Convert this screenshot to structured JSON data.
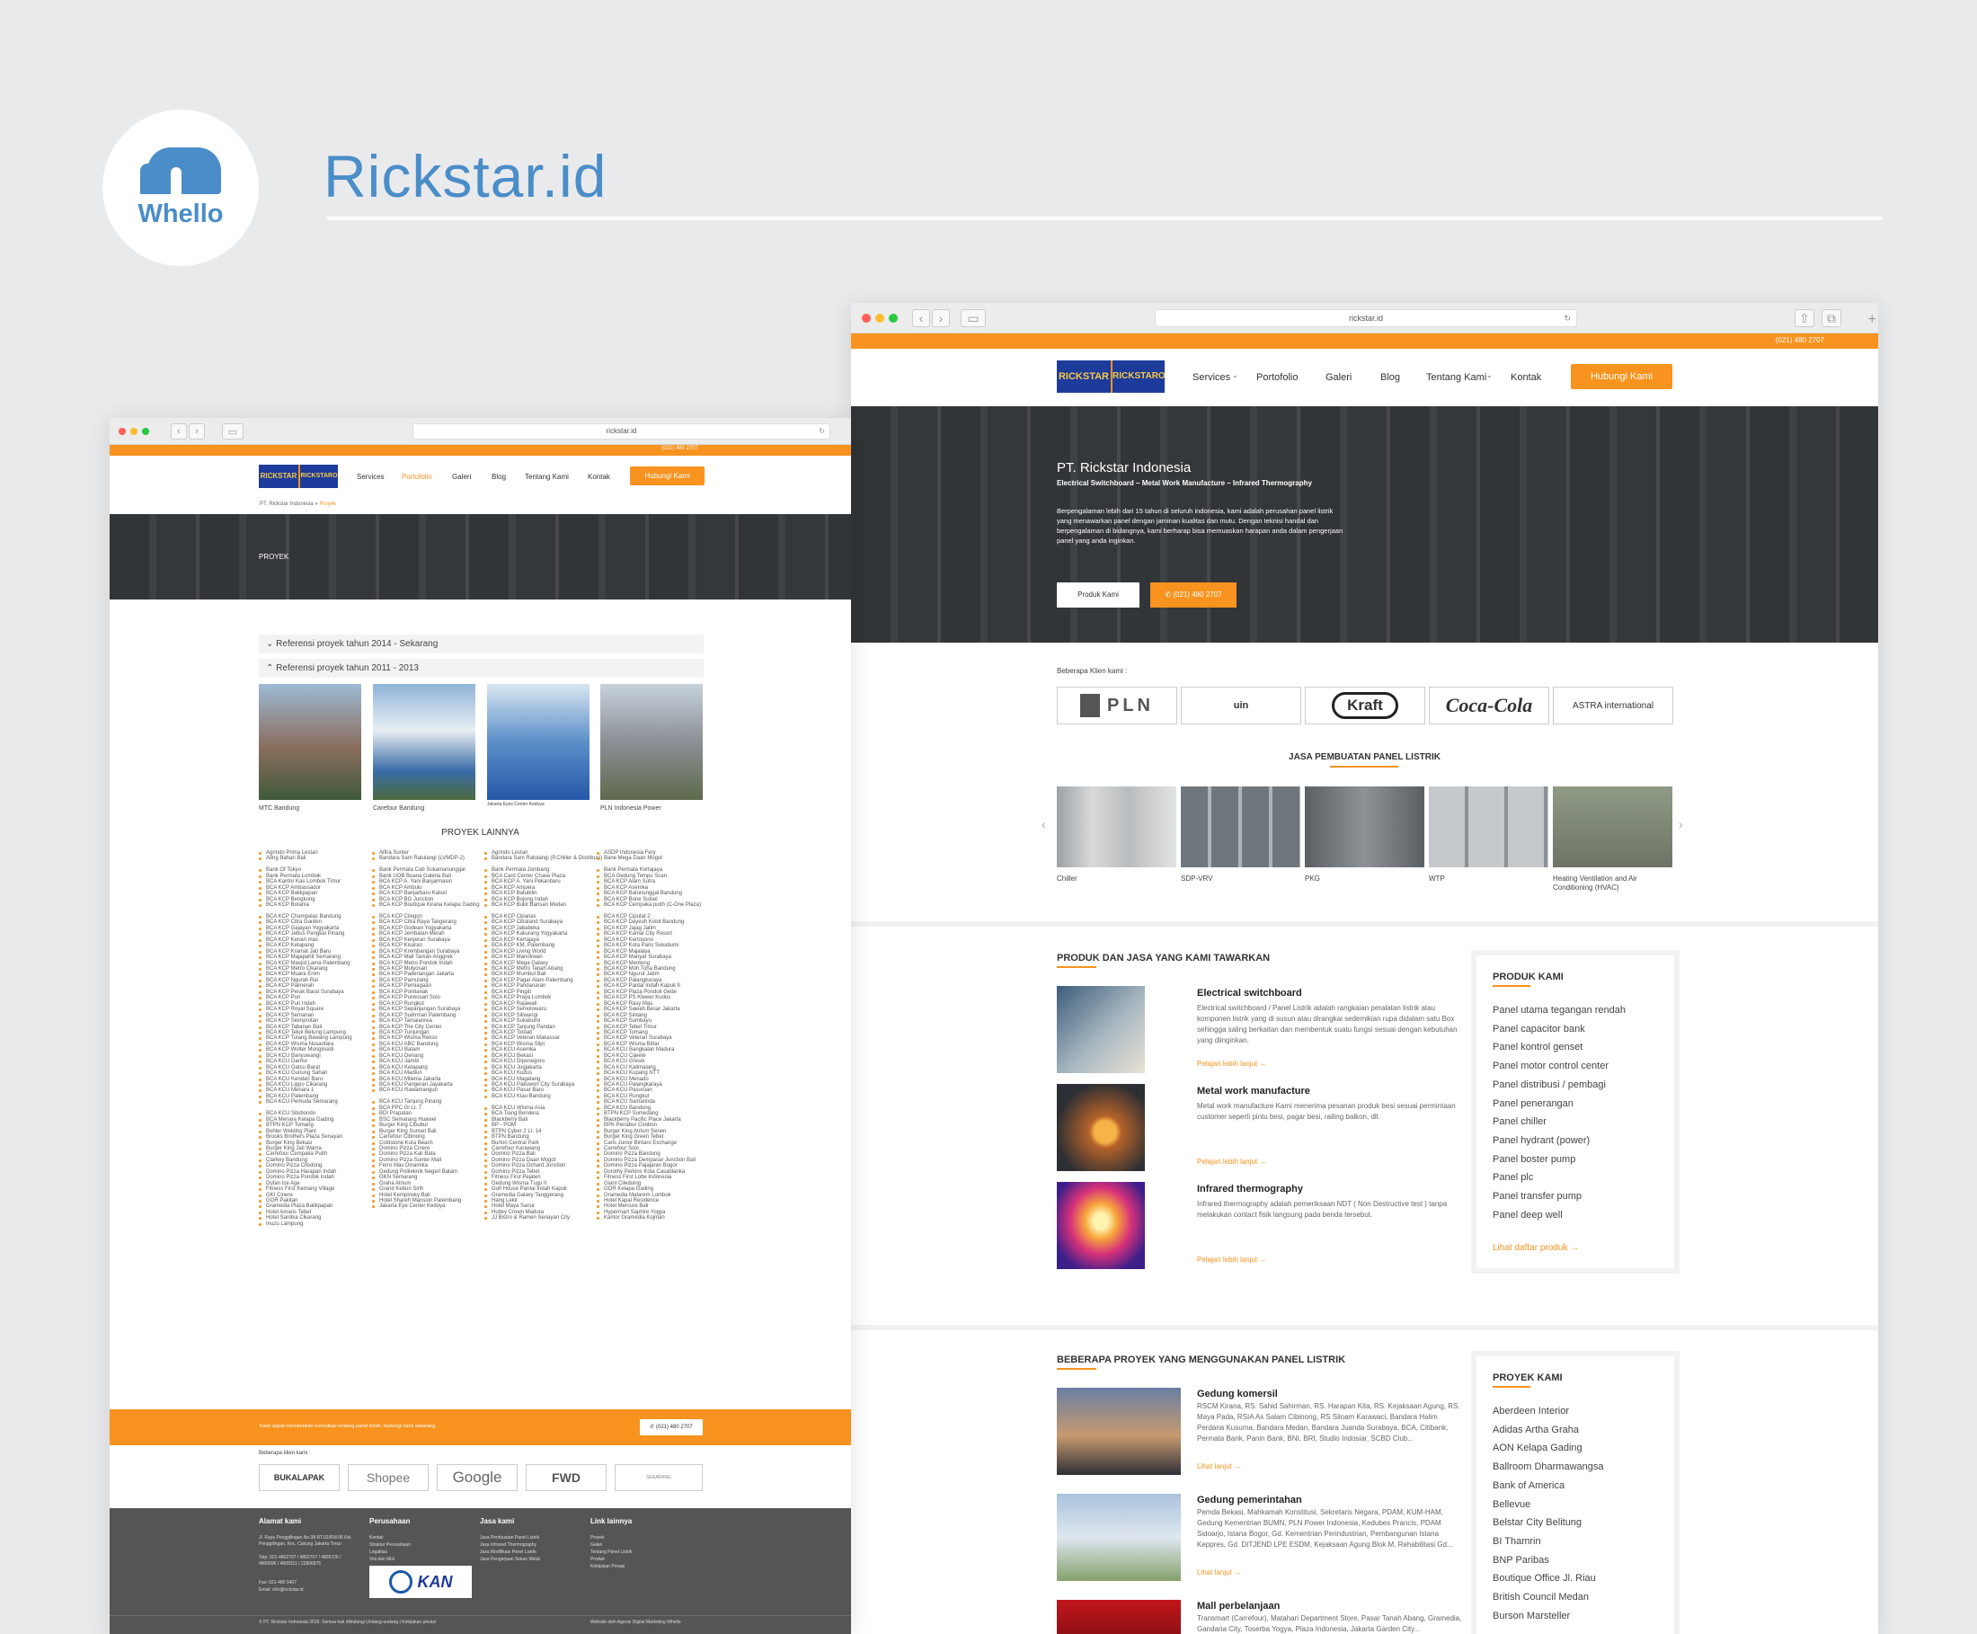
{
  "brand": {
    "logo_text": "Whello",
    "title": "Rickstar.id"
  },
  "browser": {
    "url": "rickstar.id"
  },
  "site": {
    "phone": "(021) 480 2707",
    "brand_left": "RICKSTAR",
    "brand_right": "RICKSTARO",
    "nav": [
      "Services",
      "Portofolio",
      "Galeri",
      "Blog",
      "Tentang Kami",
      "Kontak"
    ],
    "cta": "Hubungi Kami"
  },
  "left": {
    "breadcrumb_root": "PT. Rickstar Indonesia",
    "breadcrumb_current": "Proyek",
    "hero_title": "PROYEK",
    "accordion": [
      "Referensi proyek tahun 2014 - Sekarang",
      "Referensi proyek tahun 2011 - 2013"
    ],
    "photos": [
      "MTC Bandung",
      "Carefour Bandung",
      "Jakarta Eyes Center Kedoya",
      "PLN Indonesia Power"
    ],
    "others_title": "PROYEK LAINNYA",
    "col1": [
      "Agrindo Prima Lestari",
      "Ating Bahari Bali",
      "",
      "Bank Of Tokyo",
      "Bank Permata Lombok",
      "BCA Kantor Kas Lombok Timur",
      "BCA KCP Ambassador",
      "BCA KCP Balikpapan",
      "BCA KCP Bengkong",
      "BCA KCP Botania",
      "",
      "BCA KCP Champalas Bandung",
      "BCA KCP Citra Garden",
      "BCA KCP Gajayan Yogyakarta",
      "BCA KCP Jebus Pangkal Pinang",
      "BCA KCP Kenari mas",
      "BCA KCP Ketapang",
      "BCA KCP Kramat Jati Baru",
      "BCA KCP Majapahit Semarang",
      "BCA KCP Masjid Lama Palembang",
      "BCA KCP Metro Cikarang",
      "BCA KCP Muara Enim",
      "BCA KCP Ngurah Rai",
      "BCA KCP Palmerah",
      "BCA KCP Perak Barat Surabaya",
      "BCA KCP Puri",
      "BCA KCP Puri Indah",
      "BCA KCP Royal Square",
      "BCA KCP Semanan",
      "BCA KCP Siomprotan",
      "BCA KCP Tabanan Bali",
      "BCA KCP Teluk Betung Lampung",
      "BCA KCP Tulang Bawang Lampung",
      "BCA KCP Wisma Nusantara",
      "BCA KCP Wolter Monginsidi",
      "BCA KCU Banyuwangi",
      "BCA KCU Darmo",
      "BCA KCU Gatsu Barat",
      "BCA KCU Gunung Sahari",
      "BCA KCU Kendari Baru",
      "BCA KCU Lippo Cikarang",
      "BCA KCU Menara 1",
      "BCA KCU Palembang",
      "BCA KCU Pemuda Semarang",
      "",
      "BCA KCU Situbondo",
      "BCA Menara Kelapa Gading",
      "BTPN KCP Tomang",
      "Bohler Welding Plant",
      "Brooks Brothers Plaza Senayan",
      "Burger King Bekasi",
      "Burger King Jati Warna",
      "Carrefour Cempaka Putih",
      "Clarkey Bandung",
      "Domino Pizza Cilodong",
      "Domino Pizza Harapan Indah",
      "Domino Pizza Pondok Indah",
      "Dufan Ice Age",
      "Fitness First Kemang Village",
      "GKI Cinere",
      "GOR Pakitan",
      "Gramedia Plaza Balikpapan",
      "Hotel Amaris Tebet",
      "Hotel Santika Cikarang",
      "Inuzu Lampung"
    ],
    "col2": [
      "Alfira Sunter",
      "Bandara Sam Ratulangi (LVMDP-2)",
      "",
      "Bank Permata Cab Sukamanunggal",
      "Bank UOB Buana Galeria Bali",
      "BCA KCP A. Yani Banjarmasin",
      "BCA KCP Ambulu",
      "BCA KCP Banjarbaru Kalsel",
      "BCA KCP BG Junction",
      "BCA KCP Boutique Kirana Kelapa Gading",
      "",
      "BCA KCP Cilegon",
      "BCA KCP Citra Raya Tangerang",
      "BCA KCP Godean Yogyakarta",
      "BCA KCP Jembatan Merah",
      "BCA KCP Kenjeran Surabaya",
      "BCA KCP Kisaran",
      "BCA KCP Krembangan Surabaya",
      "BCA KCP Mall Taman Anggrek",
      "BCA KCP Metro Pondok Indah",
      "BCA KCP Mulyosari",
      "BCA KCP Padenangan Jakarta",
      "BCA KCP Pamulang",
      "BCA KCP Pemiagaan",
      "BCA KCP Pontianak",
      "BCA KCP Purwosari Solo",
      "BCA KCP Rungkut",
      "BCA KCP Sepanjangan Surabaya",
      "BCA KCP Sudirman Palembang",
      "BCA KCP Tamalanrea",
      "BCA KCP The City Center",
      "BCA KCP Tunjungan",
      "BCA KCP Wisma Rekso",
      "BCA KCU ABC Bandung",
      "BCA KCU Batam",
      "BCA KCU Denang",
      "BCA KCU Jambi",
      "BCA KCU Ketapang",
      "BCA KCU Madiun",
      "BCA KCU Milenia Jakarta",
      "BCA KCU Pangeran Jayakarta",
      "BCA KCU Rawamangun",
      "",
      "BCA KCU Tanjung Pinang",
      "BCA PPC Gl Lt. 7",
      "BDI Prapatan",
      "BSC Semarang Huawei",
      "Burger King Cibubur",
      "Burger King Sunset Bali",
      "Carrefour Cibinong",
      "Coldstone Kuta Beach",
      "Domino Pizza Cinere",
      "Domino Pizza Kali Bata",
      "Domino Pizza Sunter Mall",
      "Ferro Mas Dinamika",
      "Gedung Politeknik Negeri Batam",
      "GKN Semarang",
      "Graha Atrium",
      "Grand Kebon Sirih",
      "Hotel Kempinsky Bali",
      "Hotel Shareh Mansion Palembang",
      "Jakarta Eye Center Kedoya"
    ],
    "col3": [
      "Agrindo Lestari",
      "Bandara Sam Ratulangi (P.Chiller & Distribusi)",
      "",
      "Bank Permata Jombang",
      "BCA Card Center Chase Plaza",
      "BCA KCP A. Yani Pekanbaru",
      "BCA KCP Ampera",
      "BCA KCP Batubilin",
      "BCA KCP Bojong Indah",
      "BCA KCP Bukit Barisan Medan",
      "",
      "BCA KCP Cipanas",
      "BCA KCP Citraland Surabaya",
      "BCA KCP Jababeka",
      "BCA KCP Kaliurang Yogyakarta",
      "BCA KCP Kertajaya",
      "BCA KCP KM. Palembang",
      "BCA KCP Living World",
      "BCA KCP Manokwari",
      "BCA KCP Mega Galaxy",
      "BCA KCP Metro Tanah Abang",
      "BCA KCP Mumbul Bali",
      "BCA KCP Pagar Alam Palembang",
      "BCA KCP Pandanaran",
      "BCA KCP Pingiti",
      "BCA KCP Praya Lombok",
      "BCA KCP Rajawali",
      "BCA KCP Semolowaru",
      "BCA KCP Siliwangi",
      "BCA KCP Sukabumi",
      "BCA KCP Tanjung Pandan",
      "BCA KCP Tidoati",
      "BCA KCP Veteran Makassar",
      "BCA KCP Wisma Slipi",
      "BCA KCU Asemka",
      "BCA KCU Bekasi",
      "BCA KCU Diponegoro",
      "BCA KCU Jogjakarta",
      "BCA KCU Kudus",
      "BCA KCU Magelang",
      "BCA KCU Pakuwon City Surabaya",
      "BCA KCU Pasar Baru",
      "BCA KCU Klau Bandung",
      "",
      "BCA KCU Wisma Asia",
      "BCA Tiang Bendera",
      "Blackberry Bali",
      "BP - POM",
      "BTPN Cyber 2 Lt. 14",
      "BTPN Bandung",
      "Burton Central Park",
      "Carrefour Karawang",
      "Domino Pizza Bali",
      "Domino Pizza Daan Mogot",
      "Domino Pizza Ochard Junction",
      "Domino Pizza Tebet",
      "Fitness First Pejaten",
      "Gedung Wisma Tugu II",
      "Golf House Pantai Indah Kapuk",
      "Gramedia Galaxy Tanggerang",
      "Hang Lekir",
      "Hotel Maya Sanur",
      "Hutley Crown Madura",
      "JJ Bistro & Ramen Senayan City"
    ],
    "col4": [
      "ASDP Indonesia Fery",
      "Bane Mega Daan Mogot",
      "",
      "Bank Permata Kertajaya",
      "BCA Gedung Tempo Scan",
      "BCA KCP Alam Sutra",
      "BCA KCP Asemka",
      "BCA KCP Batununggal Bandung",
      "BCA KCP Bone Sulsel",
      "BCA KCP Cempaka putih (C-One Plaza)",
      "",
      "BCA KCP Ciputat 2",
      "BCA KCP Dayeuh Kolot Bandung",
      "BCA KCP Jajag Jatim",
      "BCA KCP Kamal City Resort",
      "BCA KCP Kertosono",
      "BCA KCP Kota Paris Sukabumi",
      "BCA KCP Majalaya",
      "BCA KCP Manyar Surabaya",
      "BCA KCP Menteng",
      "BCA KCP Moh.Toha Bandung",
      "BCA KCP Ngurut Jatim",
      "BCA KCP Palangkaraya",
      "BCA KCP Pantai Indah Kapuk II",
      "BCA KCP Plaza Pondok Gede",
      "BCA KCP PS Klewer Kudus",
      "BCA KCP Rasy Mas",
      "BCA KCP Sawah Besar Jakarta",
      "BCA KCP Sintang",
      "BCA KCP Sumbayu",
      "BCA KCP Tebet Timur",
      "BCA KCP Tomang",
      "BCA KCP Veteran Surabaya",
      "BCA KCP Wisma Bittar",
      "BCA KCU Bangkalan Madura",
      "BCA KCU Cijeete",
      "BCA KCU Gresik",
      "BCA KCU Kalimalang",
      "BCA KCU Kupang NTT",
      "BCA KCU Menado",
      "BCA KCU Palangkaraya",
      "BCA KCU Pasuruan",
      "BCA KCU Rungkut",
      "BCA KCU Samarinda",
      "BCA KCU Bandung",
      "BTPN KCP Sumedang",
      "Blackberry Pacific Place Jakarta",
      "BPK Penabur Cirebon",
      "Burger King Atrium Senen",
      "Burger King Green Tebet",
      "Carls Junior Bintaro Exchange",
      "Carrefour Solo",
      "Domino Pizza Bandung",
      "Domino Pizza Dempasar Junction Bali",
      "Domino Pizza Pajajaran Bogor",
      "Dorothy Perkins Kota Casablanka",
      "Fitness First Lotte Indonesia",
      "Giant Cileduing",
      "GOR Kelapa Gading",
      "Gramedia Matarem Lombok",
      "Hotel Kapal Residence",
      "Hotel Mercure Bali",
      "Hypermart Saphire Yogya",
      "Kantor Gramedia Kojman"
    ],
    "consult_text": "Kami dapat memberikan konsultasi tentang panel listrik. Hubungi kami sekarang.",
    "clients_label": "Beberapa klien kami :",
    "clients": [
      "BUKALAPAK",
      "Shopee",
      "Google",
      "FWD",
      "SEKARANG"
    ],
    "footer": {
      "cols": [
        "Alamat kami",
        "Perusahaan",
        "Jasa kami",
        "Link lainnya"
      ],
      "address": "Jl. Raya Penggilingan No.38 RT.02/RW.06 Kel. Penggilingan, Kec. Cakung Jakarta Timur",
      "tel": "Telp: 021-4802707 / 4802707 / 4805726 / 4800696 / 4805311 / 22806875",
      "fax": "Fax: 021-480 5407",
      "email": "Email: info@rickstar.id",
      "company": [
        "Kontak",
        "Struktur Perusahaan",
        "Legalitas",
        "Visi dan Misi"
      ],
      "services": [
        "Jasa Pembuatan Panel Listrik",
        "Jasa Infrared Thermography",
        "Jasa Modifikasi Panel Listrik",
        "Jasa Pengerjaan Sekan Metal"
      ],
      "links": [
        "Proyek",
        "Galeri",
        "Tentang Panel Listrik",
        "Produk",
        "Kebijakan Privasi"
      ],
      "kan": "KAN",
      "copyright": "© PT. Rickstar Indonesia 2019. Semua hak dilindungi Undang-undang | Kebijakan privasi",
      "credit": "Website oleh Agensi Digital Marketing Whello"
    }
  },
  "right": {
    "hero_title": "PT. Rickstar Indonesia",
    "hero_sub": "Electrical Switchboard – Metal Work Manufacture – Infrared Thermography",
    "hero_body": "Berpengalaman lebih dari 15 tahun di seluruh indonesia, kami adalah perusahan panel listrik yang menawarkan panel dengan jaminan kualitas dan mutu. Dengan teknisi handal dan berpengalaman di bidangnya, kami berharap bisa memuaskan harapan anda dalam pengerjaan panel yang anda inginkan.",
    "btn_product": "Produk Kami",
    "btn_phone": "(021) 480 2707",
    "clients_label": "Beberapa Klien kami :",
    "clients": [
      "PLN",
      "uin",
      "Kraft",
      "Coca-Cola",
      "ASTRA international"
    ],
    "service_title": "JASA PEMBUATAN PANEL LISTRIK",
    "service_items": [
      "Chiller",
      "SDP-VRV",
      "PKG",
      "WTP",
      "Heating Ventilation and Air Conditioning (HVAC)"
    ],
    "products_title": "PRODUK DAN JASA YANG KAMI TAWARKAN",
    "products": [
      {
        "title": "Electrical switchboard",
        "desc": "Electrical switchboard / Panel Listrik adalah rangkaian peralatan listrik atau komponen listrik yang di susun atau dirangkai sedemikian rupa didalam satu Box sehingga saling berkaitan dan membentuk suatu fungsi sesuai dengan kebutuhan yang diinginkan.",
        "more": "Pelajari lebih lanjut"
      },
      {
        "title": "Metal work manufacture",
        "desc": "Metal work manufacture Kami menerima pesanan produk besi sesuai permintaan customer seperti pintu besi, pagar besi, railing balkon, dll.",
        "more": "Pelajari lebih lanjut"
      },
      {
        "title": "Infrared thermography",
        "desc": "Infrared thermography adalah pemeriksaan NDT ( Non Destructive test ) tanpa melakukan contact fisik langsung pada benda tersebut.",
        "more": "Pelajari lebih lanjut"
      }
    ],
    "sidebar_products_title": "PRODUK KAMI",
    "sidebar_products": [
      "Panel utama tegangan rendah",
      "Panel capacitor bank",
      "Panel kontrol genset",
      "Panel motor control center",
      "Panel distribusi / pembagi",
      "Panel penerangan",
      "Panel chiller",
      "Panel hydrant (power)",
      "Panel boster pump",
      "Panel plc",
      "Panel transfer pump",
      "Panel deep well"
    ],
    "sidebar_products_more": "Lihat daftar produk",
    "projects_title": "BEBERAPA PROYEK YANG MENGGUNAKAN PANEL LISTRIK",
    "projects": [
      {
        "title": "Gedung komersil",
        "desc": "RSCM Kirana, RS. Sahid Sahirman, RS. Harapan Kita, RS. Kejaksaan Agung, RS. Maya Pada, RSIA As Salam Cibinong, RS Siloam Karawaci, Bandara Halim Perdana Kusuma, Bandara Medan, Bandara Juanda Surabaya, BCA, Citibank, Permata Bank, Panin Bank, BNI, BRI, Studio Indosiar, SCBD Club...",
        "more": "Lihat lanjut"
      },
      {
        "title": "Gedung pemerintahan",
        "desc": "Pemda Bekasi, Mahkamah Konstitusi, Sekretaris Negara, PDAM, KUM-HAM, Gedung Kementrian BUMN, PLN Power Indonesia, Kedubes Prancis, PDAM Sidoarjo, Istana Bogor, Gd. Kementrian Perindustrian, Pembangunan Istana Keppres, Gd. DITJEND LPE ESDM, Kejaksaan Agung Blok M, Rehabilitasi Gd...",
        "more": "Lihat lanjut"
      },
      {
        "title": "Mall perbelanjaan",
        "desc": "Transmart (Carrefour), Matahari Department Store, Pasar Tanah Abang, Gramedia, Gandaria City, Toserba Yogya, Plaza Indonesia, Jakarta Garden City..."
      }
    ],
    "sidebar_projects_title": "PROYEK KAMI",
    "sidebar_projects": [
      "Aberdeen Interior",
      "Adidas Artha Graha",
      "AON Kelapa Gading",
      "Ballroom Dharmawangsa",
      "Bank of America",
      "Bellevue",
      "Belstar City Belitung",
      "BI Thamrin",
      "BNP Paribas",
      "Boutique Office Jl. Riau",
      "British Council Medan",
      "Burson Marsteller"
    ]
  },
  "colors": {
    "accent": "#f7931e",
    "brand_blue": "#4a8dc8",
    "navy": "#1d3b9a"
  }
}
